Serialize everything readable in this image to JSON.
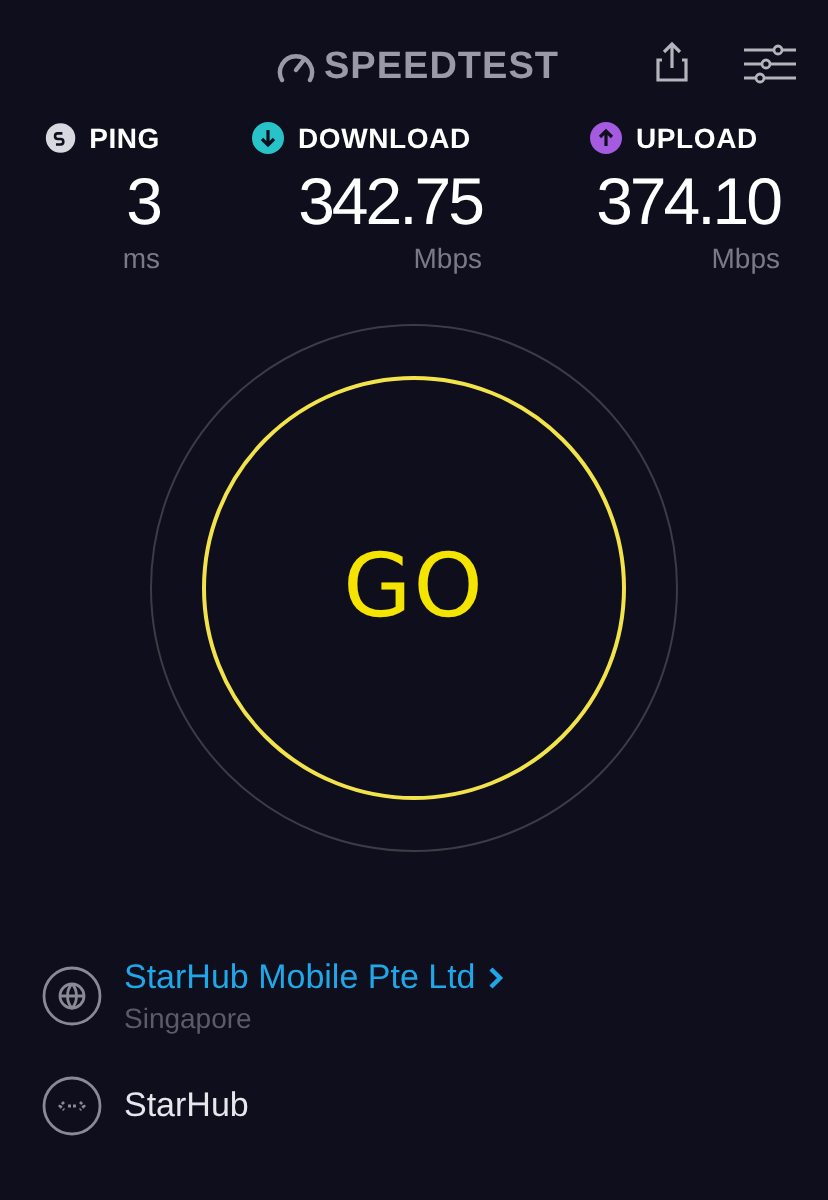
{
  "header": {
    "logo": "SPEEDTEST"
  },
  "metrics": [
    {
      "kind": "ping",
      "label": "PING",
      "value": "3",
      "unit": "ms",
      "color": "#d8d8e0"
    },
    {
      "kind": "download",
      "label": "DOWNLOAD",
      "value": "342.75",
      "unit": "Mbps",
      "color": "#27c3c8"
    },
    {
      "kind": "upload",
      "label": "UPLOAD",
      "value": "374.10",
      "unit": "Mbps",
      "color": "#a45be0"
    }
  ],
  "go_button": {
    "label": "GO"
  },
  "server": {
    "name": "StarHub Mobile Pte Ltd",
    "location": "Singapore"
  },
  "provider": {
    "name": "StarHub"
  }
}
